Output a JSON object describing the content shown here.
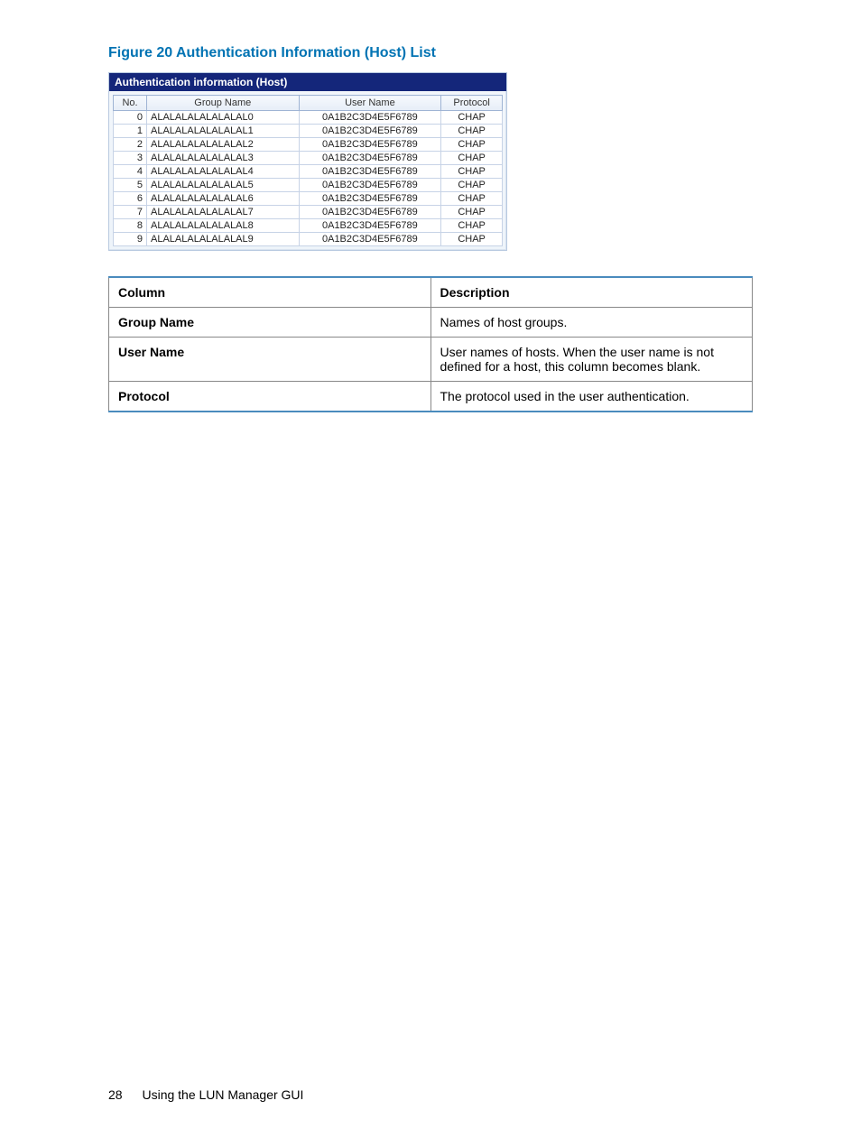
{
  "figure_caption": "Figure 20 Authentication Information (Host) List",
  "panel_title": "Authentication information (Host)",
  "auth_headers": {
    "no": "No.",
    "group": "Group Name",
    "user": "User Name",
    "protocol": "Protocol"
  },
  "auth_rows": [
    {
      "no": "0",
      "group": "ALALALALALALALAL0",
      "user": "0A1B2C3D4E5F6789",
      "protocol": "CHAP"
    },
    {
      "no": "1",
      "group": "ALALALALALALALAL1",
      "user": "0A1B2C3D4E5F6789",
      "protocol": "CHAP"
    },
    {
      "no": "2",
      "group": "ALALALALALALALAL2",
      "user": "0A1B2C3D4E5F6789",
      "protocol": "CHAP"
    },
    {
      "no": "3",
      "group": "ALALALALALALALAL3",
      "user": "0A1B2C3D4E5F6789",
      "protocol": "CHAP"
    },
    {
      "no": "4",
      "group": "ALALALALALALALAL4",
      "user": "0A1B2C3D4E5F6789",
      "protocol": "CHAP"
    },
    {
      "no": "5",
      "group": "ALALALALALALALAL5",
      "user": "0A1B2C3D4E5F6789",
      "protocol": "CHAP"
    },
    {
      "no": "6",
      "group": "ALALALALALALALAL6",
      "user": "0A1B2C3D4E5F6789",
      "protocol": "CHAP"
    },
    {
      "no": "7",
      "group": "ALALALALALALALAL7",
      "user": "0A1B2C3D4E5F6789",
      "protocol": "CHAP"
    },
    {
      "no": "8",
      "group": "ALALALALALALALAL8",
      "user": "0A1B2C3D4E5F6789",
      "protocol": "CHAP"
    },
    {
      "no": "9",
      "group": "ALALALALALALALAL9",
      "user": "0A1B2C3D4E5F6789",
      "protocol": "CHAP"
    }
  ],
  "desc_headers": {
    "col": "Column",
    "desc": "Description"
  },
  "desc_rows": [
    {
      "col": "Group Name",
      "desc": "Names of host groups."
    },
    {
      "col": "User Name",
      "desc": "User names of hosts. When the user name is not defined for a host, this column becomes blank."
    },
    {
      "col": "Protocol",
      "desc": "The protocol used in the user authentication."
    }
  ],
  "footer": {
    "page": "28",
    "section": "Using the LUN Manager GUI"
  }
}
